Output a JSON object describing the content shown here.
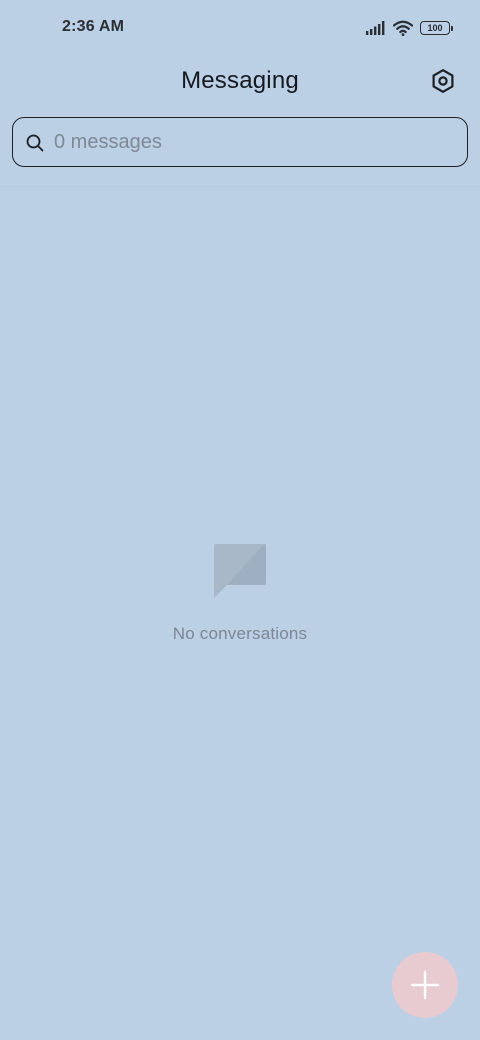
{
  "status_bar": {
    "time": "2:36 AM",
    "battery": "100",
    "signal_icon": "signal-icon",
    "wifi_icon": "wifi-icon"
  },
  "header": {
    "title": "Messaging",
    "settings_icon": "settings-icon"
  },
  "search": {
    "placeholder": "0 messages",
    "value": "",
    "icon": "search-icon"
  },
  "empty_state": {
    "icon": "chat-bubble-icon",
    "text": "No conversations"
  },
  "fab": {
    "icon": "plus-icon",
    "color": "#e8cbd1"
  },
  "colors": {
    "background": "#bbcfe5",
    "text_primary": "#15191f",
    "text_muted": "#7c8794"
  }
}
